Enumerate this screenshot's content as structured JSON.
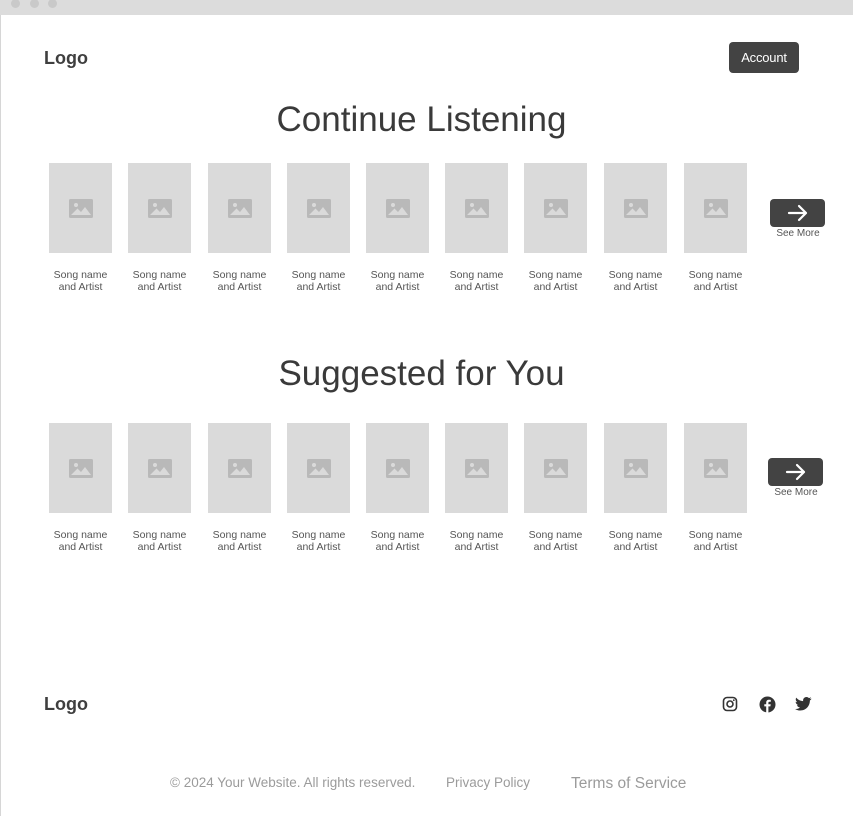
{
  "header": {
    "logo": "Logo",
    "account_label": "Account"
  },
  "sections": [
    {
      "title": "Continue Listening",
      "see_more": "See More",
      "items": [
        {
          "line1": "Song name",
          "line2": "and Artist"
        },
        {
          "line1": "Song name",
          "line2": "and Artist"
        },
        {
          "line1": "Song name",
          "line2": "and Artist"
        },
        {
          "line1": "Song name",
          "line2": "and Artist"
        },
        {
          "line1": "Song name",
          "line2": "and Artist"
        },
        {
          "line1": "Song name",
          "line2": "and Artist"
        },
        {
          "line1": "Song name",
          "line2": "and Artist"
        },
        {
          "line1": "Song name",
          "line2": "and Artist"
        },
        {
          "line1": "Song name",
          "line2": "and Artist"
        }
      ]
    },
    {
      "title": "Suggested for You",
      "see_more": "See More",
      "items": [
        {
          "line1": "Song name",
          "line2": "and Artist"
        },
        {
          "line1": "Song name",
          "line2": "and Artist"
        },
        {
          "line1": "Song name",
          "line2": "and Artist"
        },
        {
          "line1": "Song name",
          "line2": "and Artist"
        },
        {
          "line1": "Song name",
          "line2": "and Artist"
        },
        {
          "line1": "Song name",
          "line2": "and Artist"
        },
        {
          "line1": "Song name",
          "line2": "and Artist"
        },
        {
          "line1": "Song name",
          "line2": "and Artist"
        },
        {
          "line1": "Song name",
          "line2": "and Artist"
        }
      ]
    }
  ],
  "footer": {
    "logo": "Logo",
    "social_icons": [
      "instagram-icon",
      "facebook-icon",
      "twitter-icon"
    ],
    "copyright": "© 2024 Your Website. All rights reserved.",
    "privacy": "Privacy Policy",
    "terms": "Terms of Service"
  },
  "colors": {
    "accent": "#434343",
    "placeholder": "#dadada",
    "text": "#3f3f3f",
    "muted": "#9b9b9b"
  }
}
